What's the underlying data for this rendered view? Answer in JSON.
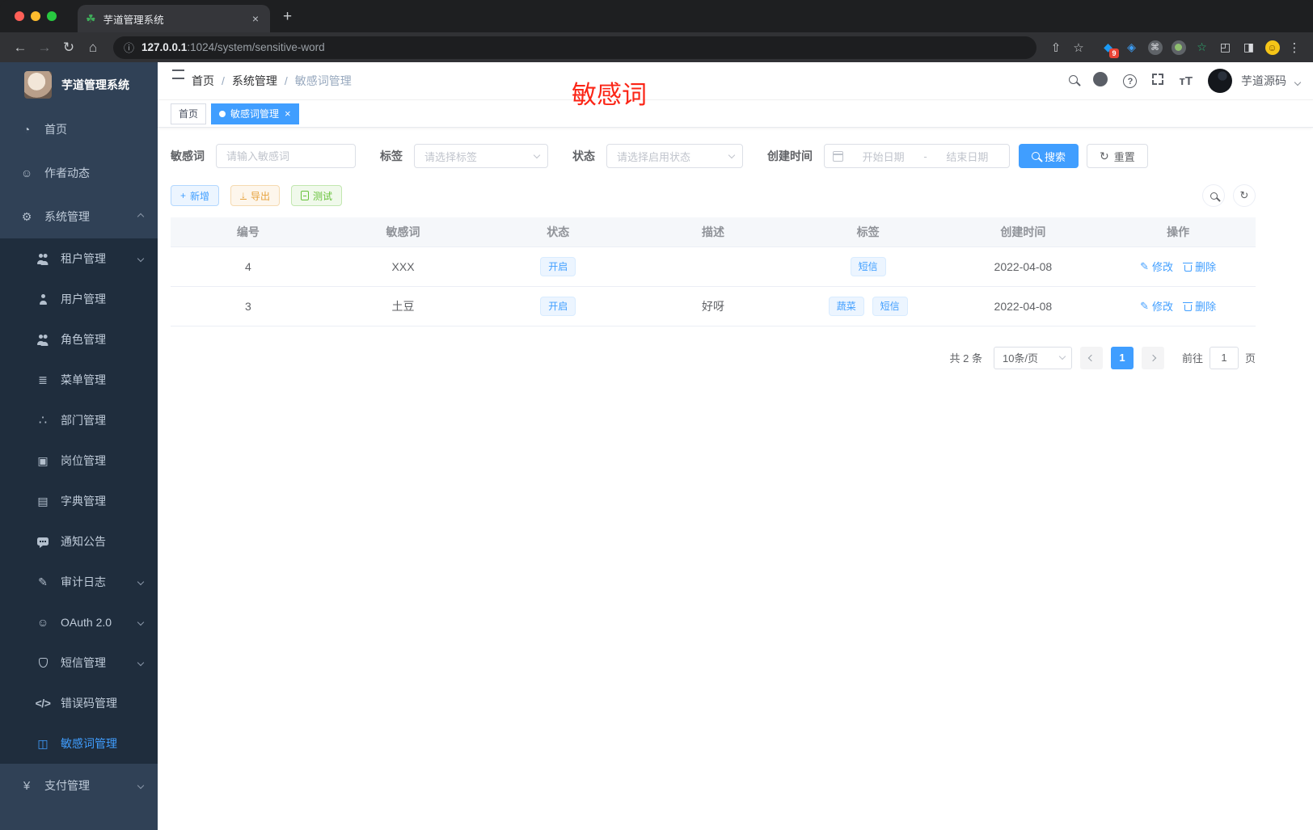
{
  "browser": {
    "tab_title": "芋道管理系统",
    "url_host": "127.0.0.1",
    "url_path": ":1024/system/sensitive-word",
    "ext_badge": "9"
  },
  "sidebar": {
    "logo_title": "芋道管理系统",
    "items": [
      {
        "label": "首页"
      },
      {
        "label": "作者动态"
      },
      {
        "label": "系统管理"
      },
      {
        "label": "租户管理"
      },
      {
        "label": "用户管理"
      },
      {
        "label": "角色管理"
      },
      {
        "label": "菜单管理"
      },
      {
        "label": "部门管理"
      },
      {
        "label": "岗位管理"
      },
      {
        "label": "字典管理"
      },
      {
        "label": "通知公告"
      },
      {
        "label": "审计日志"
      },
      {
        "label": "OAuth 2.0"
      },
      {
        "label": "短信管理"
      },
      {
        "label": "错误码管理"
      },
      {
        "label": "敏感词管理"
      },
      {
        "label": "支付管理"
      }
    ]
  },
  "navbar": {
    "breadcrumb": {
      "home": "首页",
      "section": "系统管理",
      "current": "敏感词管理",
      "sep": "/"
    },
    "username": "芋道源码"
  },
  "annotation": {
    "text": "敏感词",
    "color": "#fb2516"
  },
  "tags_view": {
    "home": "首页",
    "active": "敏感词管理"
  },
  "filters": {
    "keyword_label": "敏感词",
    "keyword_placeholder": "请输入敏感词",
    "tag_label": "标签",
    "tag_placeholder": "请选择标签",
    "status_label": "状态",
    "status_placeholder": "请选择启用状态",
    "date_label": "创建时间",
    "date_start": "开始日期",
    "date_separator": "-",
    "date_end": "结束日期",
    "search_label": "搜索",
    "reset_label": "重置"
  },
  "actions": {
    "add": "新增",
    "export": "导出",
    "test": "测试"
  },
  "table": {
    "headers": [
      "编号",
      "敏感词",
      "状态",
      "描述",
      "标签",
      "创建时间",
      "操作"
    ],
    "edit_label": "修改",
    "delete_label": "删除",
    "rows": [
      {
        "id": "4",
        "word": "XXX",
        "status": "开启",
        "description": "",
        "tags": [
          "短信"
        ],
        "created_at": "2022-04-08"
      },
      {
        "id": "3",
        "word": "土豆",
        "status": "开启",
        "description": "好呀",
        "tags": [
          "蔬菜",
          "短信"
        ],
        "created_at": "2022-04-08"
      }
    ]
  },
  "pagination": {
    "total": "共 2 条",
    "page_size": "10条/页",
    "current_page": "1",
    "goto_label": "前往",
    "goto_value": "1",
    "unit_label": "页"
  },
  "icons": {
    "favicon": "☘",
    "back": "←",
    "forward": "→",
    "reload": "↻",
    "home": "⌂",
    "info": "ⓘ",
    "share": "⇧",
    "bookmark": "☆",
    "menu_dots": "⋮",
    "new_tab": "+",
    "close": "×",
    "ext_update": "◆",
    "ext_gem": "◈",
    "ext_cmd": "⌘",
    "ext_star": "☆",
    "ext_puzzle": "◰",
    "ext_panel": "◨",
    "ext_emoji": "☺",
    "dashboard": "◔",
    "face": "☺",
    "gear": "⚙",
    "tree": "≣",
    "org": "∴",
    "badge": "▣",
    "dict": "▤",
    "pen": "✎",
    "code": "</>",
    "book": "◫",
    "yen": "¥",
    "refresh": "↻",
    "download": "↓",
    "plus": "+",
    "question": "?",
    "fontsize": "тT",
    "prev": "‹",
    "next": "›",
    "edit": "✎"
  },
  "colors": {
    "primary": "#409eff",
    "sidebar_bg": "#304156",
    "submenu_bg": "#1f2d3d",
    "tag_bg": "#ecf5ff",
    "tag_border": "#d9ecff",
    "annotation_red": "#fb2516"
  }
}
